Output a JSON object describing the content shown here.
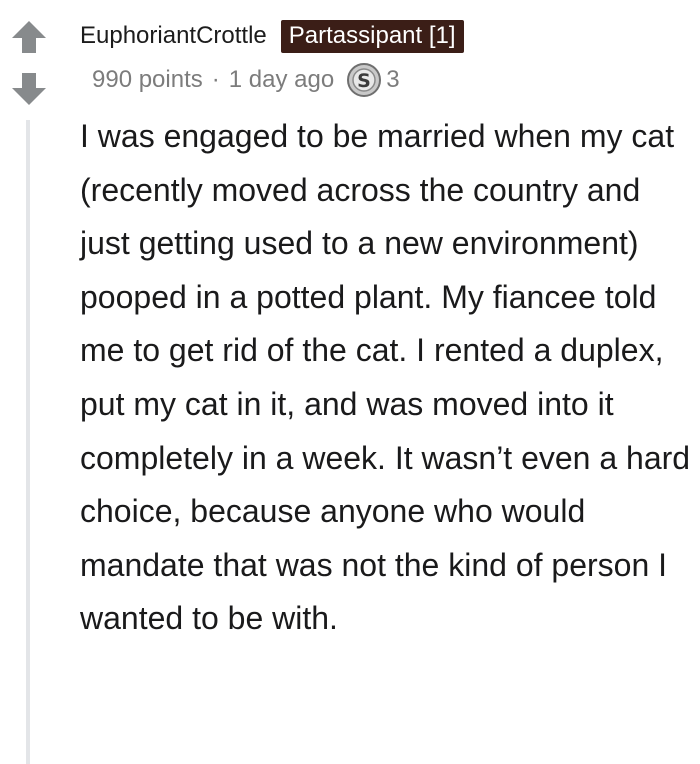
{
  "vote": {
    "upvote_icon": "arrow-up-icon",
    "downvote_icon": "arrow-down-icon",
    "color": "#878a8c"
  },
  "comment": {
    "author": "EuphoriantCrottle",
    "flair": "Partassipant [1]",
    "flair_color": "#3b1e17",
    "points": "990 points",
    "separator": "·",
    "time": "1 day ago",
    "award_icon": "silver-award-icon",
    "award_count": "3",
    "body": "I was engaged to be married when my cat (recently moved across the country and just getting used to a new environment) pooped in a potted plant. My fiancee told me to get rid of the cat. I rented a duplex, put my cat in it, and was moved into it completely in a week. It wasn’t even a hard choice, because anyone who would mandate that was not the kind of person I wanted to be with."
  }
}
